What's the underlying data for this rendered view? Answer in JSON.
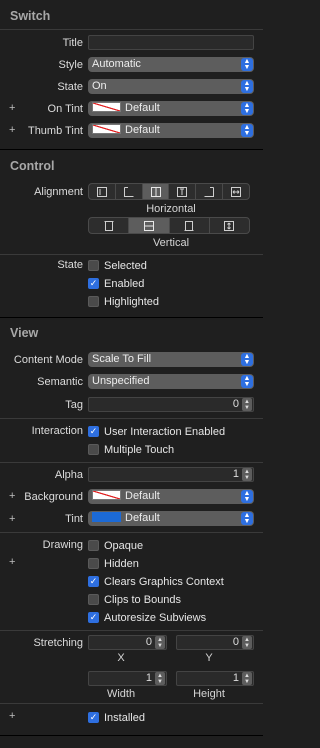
{
  "switch": {
    "title": "Switch",
    "rows": {
      "title_label": "Title",
      "title_value": "",
      "style_label": "Style",
      "style_value": "Automatic",
      "state_label": "State",
      "state_value": "On",
      "on_tint_label": "On Tint",
      "on_tint_value": "Default",
      "thumb_tint_label": "Thumb Tint",
      "thumb_tint_value": "Default"
    }
  },
  "control": {
    "title": "Control",
    "alignment_label": "Alignment",
    "horizontal_caption": "Horizontal",
    "vertical_caption": "Vertical",
    "state_label": "State",
    "states": [
      {
        "label": "Selected",
        "checked": false
      },
      {
        "label": "Enabled",
        "checked": true
      },
      {
        "label": "Highlighted",
        "checked": false
      }
    ]
  },
  "view": {
    "title": "View",
    "content_mode_label": "Content Mode",
    "content_mode_value": "Scale To Fill",
    "semantic_label": "Semantic",
    "semantic_value": "Unspecified",
    "tag_label": "Tag",
    "tag_value": "0",
    "interaction_label": "Interaction",
    "interaction": [
      {
        "label": "User Interaction Enabled",
        "checked": true
      },
      {
        "label": "Multiple Touch",
        "checked": false
      }
    ],
    "alpha_label": "Alpha",
    "alpha_value": "1",
    "background_label": "Background",
    "background_value": "Default",
    "tint_label": "Tint",
    "tint_value": "Default",
    "drawing_label": "Drawing",
    "drawing": [
      {
        "label": "Opaque",
        "checked": false
      },
      {
        "label": "Hidden",
        "checked": false
      },
      {
        "label": "Clears Graphics Context",
        "checked": true
      },
      {
        "label": "Clips to Bounds",
        "checked": false
      },
      {
        "label": "Autoresize Subviews",
        "checked": true
      }
    ],
    "stretching_label": "Stretching",
    "stretch_x": "0",
    "stretch_y": "0",
    "stretch_width": "1",
    "stretch_height": "1",
    "x_caption": "X",
    "y_caption": "Y",
    "width_caption": "Width",
    "height_caption": "Height",
    "installed_label": "Installed",
    "installed_checked": true
  },
  "glyphs": {
    "plus": "+",
    "check": "✓",
    "chevrons": "▲▼"
  },
  "colors": {
    "accent": "#2e6fe0",
    "panel": "#1f1f1f",
    "control": "#5d5d5d",
    "tint_blue": "#1c6ad6",
    "no_color_line": "#e02020"
  }
}
